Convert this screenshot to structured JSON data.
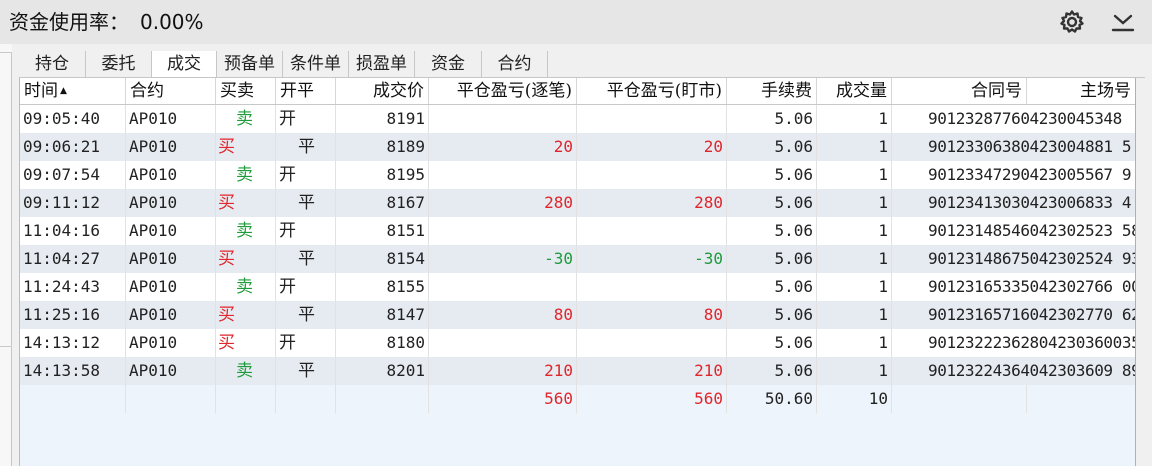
{
  "header": {
    "label": "资金使用率：",
    "value": "0.00%",
    "settings_icon": "gear-icon",
    "download_icon": "download-icon"
  },
  "tabs": [
    {
      "label": "持仓"
    },
    {
      "label": "委托"
    },
    {
      "label": "成交"
    },
    {
      "label": "预备单"
    },
    {
      "label": "条件单"
    },
    {
      "label": "损盈单"
    },
    {
      "label": "资金"
    },
    {
      "label": "合约"
    }
  ],
  "active_tab": "成交",
  "columns": [
    {
      "label": "时间",
      "sort": "asc"
    },
    {
      "label": "合约"
    },
    {
      "label": "买卖"
    },
    {
      "label": "开平"
    },
    {
      "label": "成交价"
    },
    {
      "label": "平仓盈亏(逐笔)"
    },
    {
      "label": "平仓盈亏(盯市)"
    },
    {
      "label": "手续费"
    },
    {
      "label": "成交量"
    },
    {
      "label": "合同号"
    },
    {
      "label": "主场号"
    }
  ],
  "rows": [
    {
      "time": "09:05:40",
      "contract": "AP010",
      "side": "卖",
      "openclose": "开",
      "price": "8191",
      "pnl_trade": "",
      "pnl_mark": "",
      "fee": "5.06",
      "volume": "1",
      "order_no": "901232877604230045348"
    },
    {
      "time": "09:06:21",
      "contract": "AP010",
      "side": "买",
      "openclose": "平",
      "price": "8189",
      "pnl_trade": "20",
      "pnl_mark": "20",
      "fee": "5.06",
      "volume": "1",
      "order_no": "90123306380423004881 5"
    },
    {
      "time": "09:07:54",
      "contract": "AP010",
      "side": "卖",
      "openclose": "开",
      "price": "8195",
      "pnl_trade": "",
      "pnl_mark": "",
      "fee": "5.06",
      "volume": "1",
      "order_no": "90123347290423005567 9"
    },
    {
      "time": "09:11:12",
      "contract": "AP010",
      "side": "买",
      "openclose": "平",
      "price": "8167",
      "pnl_trade": "280",
      "pnl_mark": "280",
      "fee": "5.06",
      "volume": "1",
      "order_no": "90123413030423006833 4"
    },
    {
      "time": "11:04:16",
      "contract": "AP010",
      "side": "卖",
      "openclose": "开",
      "price": "8151",
      "pnl_trade": "",
      "pnl_mark": "",
      "fee": "5.06",
      "volume": "1",
      "order_no": "90123148546042302523 58"
    },
    {
      "time": "11:04:27",
      "contract": "AP010",
      "side": "买",
      "openclose": "平",
      "price": "8154",
      "pnl_trade": "-30",
      "pnl_mark": "-30",
      "fee": "5.06",
      "volume": "1",
      "order_no": "90123148675042302524 93"
    },
    {
      "time": "11:24:43",
      "contract": "AP010",
      "side": "卖",
      "openclose": "开",
      "price": "8155",
      "pnl_trade": "",
      "pnl_mark": "",
      "fee": "5.06",
      "volume": "1",
      "order_no": "90123165335042302766 00"
    },
    {
      "time": "11:25:16",
      "contract": "AP010",
      "side": "买",
      "openclose": "平",
      "price": "8147",
      "pnl_trade": "80",
      "pnl_mark": "80",
      "fee": "5.06",
      "volume": "1",
      "order_no": "90123165716042302770 62"
    },
    {
      "time": "14:13:12",
      "contract": "AP010",
      "side": "买",
      "openclose": "开",
      "price": "8180",
      "pnl_trade": "",
      "pnl_mark": "",
      "fee": "5.06",
      "volume": "1",
      "order_no": "90123222362804230360035"
    },
    {
      "time": "14:13:58",
      "contract": "AP010",
      "side": "卖",
      "openclose": "平",
      "price": "8201",
      "pnl_trade": "210",
      "pnl_mark": "210",
      "fee": "5.06",
      "volume": "1",
      "order_no": "90123224364042303609 89"
    }
  ],
  "summary": {
    "pnl_trade": "560",
    "pnl_mark": "560",
    "fee": "50.60",
    "volume": "10"
  },
  "colors": {
    "buy": "#e0262b",
    "sell": "#1e9b3a",
    "loss": "#1e9b3a",
    "profit": "#e0262b",
    "row_alt": "#e6ebf1"
  }
}
